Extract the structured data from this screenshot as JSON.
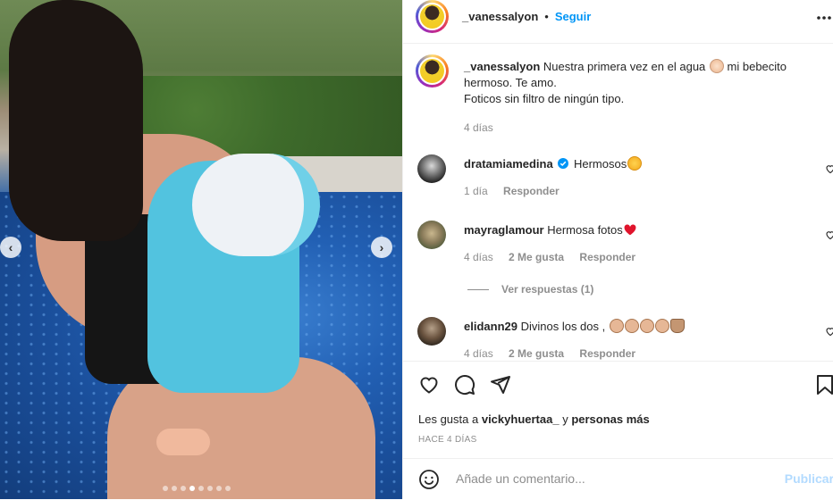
{
  "post": {
    "author": "_vanessalyon",
    "dot": "•",
    "follow_label": "Seguir",
    "more_icon": "more-horizontal-icon",
    "carousel": {
      "prev_glyph": "‹",
      "next_glyph": "›",
      "slide_count": 8,
      "active_index": 3
    }
  },
  "caption": {
    "author": "_vanessalyon",
    "text_line1": "Nuestra primera vez en el agua",
    "text_line1_b": "mi bebecito",
    "text_line2": "hermoso. Te amo.",
    "text_line3": "Foticos sin filtro de ningún tipo.",
    "time": "4 días",
    "emoji": "baby-face-emoji"
  },
  "comments": [
    {
      "user": "dratamiamedina",
      "verified": true,
      "text": "Hermosos",
      "emoji": "star-struck-emoji",
      "time": "1 día",
      "likes": "",
      "reply": "Responder"
    },
    {
      "user": "mayraglamour",
      "verified": false,
      "text": "Hermosa fotos",
      "emoji": "red-heart-emoji",
      "time": "4 días",
      "likes": "2 Me gusta",
      "reply": "Responder",
      "replies_label": "Ver respuestas (1)"
    },
    {
      "user": "elidann29",
      "verified": false,
      "text": "Divinos los dos ,",
      "emoji": "clapping-hands-emoji",
      "time": "4 días",
      "likes": "2 Me gusta",
      "reply": "Responder"
    }
  ],
  "actions": {
    "like_icon": "heart-outline-icon",
    "comment_icon": "comment-bubble-icon",
    "share_icon": "paper-plane-icon",
    "save_icon": "bookmark-icon",
    "likes_prefix": "Les gusta a",
    "likes_user": "vickyhuertaa_",
    "likes_join": "y",
    "likes_rest": "personas más",
    "posted_ago": "HACE 4 DÍAS"
  },
  "composer": {
    "emoji_icon": "smiley-icon",
    "placeholder": "Añade un comentario...",
    "publish_label": "Publicar"
  },
  "colors": {
    "accent": "#0095f6",
    "muted": "#8e8e8e",
    "text": "#262626",
    "publish_disabled": "#b3dbff",
    "like_red": "#ed4956"
  }
}
